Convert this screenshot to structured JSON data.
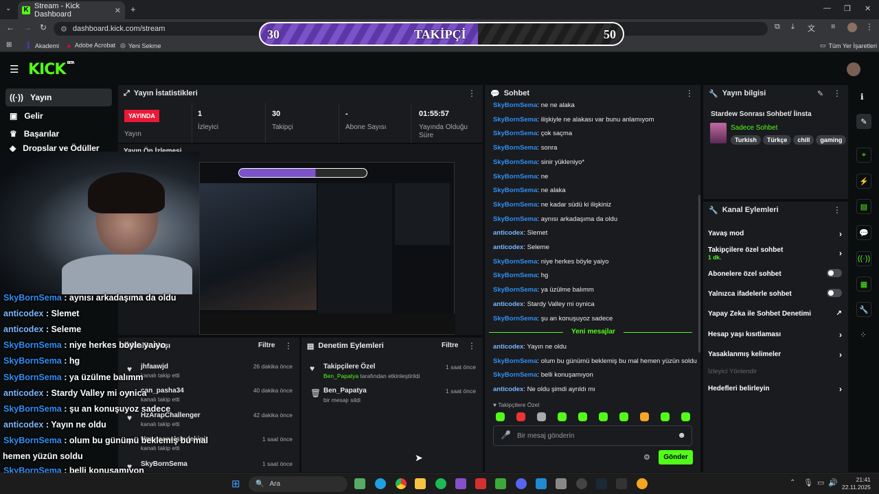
{
  "browser": {
    "tab_title": "Stream - Kick Dashboard",
    "url": "dashboard.kick.com/stream",
    "bookmarks": [
      "Akademi",
      "Adobe Acrobat",
      "Yeni Sekme"
    ],
    "all_bookmarks": "Tüm Yer İşaretleri"
  },
  "goal": {
    "start": "30",
    "label": "TAKİPÇİ",
    "end": "50",
    "progress": 0.6
  },
  "kick": {
    "logo": "KICK",
    "beta": "BETA"
  },
  "sidebar": [
    {
      "label": "Yayın",
      "icon": "broadcast-icon"
    },
    {
      "label": "Gelir",
      "icon": "revenue-icon"
    },
    {
      "label": "Başarılar",
      "icon": "achievements-icon"
    },
    {
      "label": "Dropslar ve Ödüller",
      "icon": "drops-icon"
    }
  ],
  "stats_panel": {
    "title": "Yayın İstatistikleri",
    "live_badge": "YAYINDA",
    "items": [
      {
        "value": "",
        "label": "Yayın"
      },
      {
        "value": "1",
        "label": "İzleyici"
      },
      {
        "value": "30",
        "label": "Takipçi"
      },
      {
        "value": "-",
        "label": "Abone Sayısı"
      },
      {
        "value": "01:55:57",
        "label": "Yayında Olduğu Süre"
      }
    ]
  },
  "preview_title": "Yayın Ön İzlemesi",
  "activity_panel": {
    "title": "Etkinlik Akışı",
    "filter": "Filtre",
    "items": [
      {
        "name": "jhfaawjd",
        "desc": "kanalı takip etti",
        "time": "26 dakika önce"
      },
      {
        "name": "can_pasha34",
        "desc": "kanalı takip etti",
        "time": "40 dakika önce"
      },
      {
        "name": "HzArapChallenger",
        "desc": "kanalı takip etti",
        "time": "42 dakika önce"
      },
      {
        "name": "Umutcanelsindekini",
        "desc": "kanalı takip etti",
        "time": "1 saat önce"
      },
      {
        "name": "SkyBornSema",
        "desc": "",
        "time": "1 saat önce"
      }
    ]
  },
  "mod_panel": {
    "title": "Denetim Eylemleri",
    "filter": "Filtre",
    "items": [
      {
        "name": "Takipçilere Özel",
        "user": "Ben_Papatya",
        "desc": "tarafından etkinleştirildi",
        "time": "1 saat önce"
      },
      {
        "name": "Ben_Papatya",
        "user": "",
        "desc": "bir mesajı sildi",
        "time": "1 saat önce"
      }
    ]
  },
  "chat": {
    "title": "Sohbet",
    "messages": [
      {
        "user": "SkyBornSema",
        "text": "ne ne alaka"
      },
      {
        "user": "SkyBornSema",
        "text": "ilişkiyle ne alakası var bunu anlamıyom"
      },
      {
        "user": "SkyBornSema",
        "text": "çok saçma"
      },
      {
        "user": "SkyBornSema",
        "text": "sonra"
      },
      {
        "user": "SkyBornSema",
        "text": "sinir yükleniyo*"
      },
      {
        "user": "SkyBornSema",
        "text": "ne"
      },
      {
        "user": "SkyBornSema",
        "text": "ne alaka"
      },
      {
        "user": "SkyBornSema",
        "text": "ne kadar südü ki ilişkiniz"
      },
      {
        "user": "SkyBornSema",
        "text": "aynısı arkadaşıma da oldu"
      },
      {
        "user": "anticodex",
        "text": "Slemet"
      },
      {
        "user": "anticodex",
        "text": "Seleme"
      },
      {
        "user": "SkyBornSema",
        "text": "niye herkes böyle yaiyo"
      },
      {
        "user": "SkyBornSema",
        "text": "hg"
      },
      {
        "user": "SkyBornSema",
        "text": "ya üzülme balımm"
      },
      {
        "user": "anticodex",
        "text": "Stardy Valley mi oynica"
      },
      {
        "user": "SkyBornSema",
        "text": "şu an konuşuyoz sadece"
      }
    ],
    "new_messages": "Yeni mesajlar",
    "new": [
      {
        "user": "anticodex",
        "text": "Yayın ne oldu"
      },
      {
        "user": "SkyBornSema",
        "text": "olum bu günümü beklemiş bu mal hemen yüzün soldu"
      },
      {
        "user": "SkyBornSema",
        "text": "belli konuşamıyon"
      },
      {
        "user": "anticodex",
        "text": "Ne oldu şimdi ayrıldı mı"
      }
    ],
    "followers_only": "Takipçilere Özel",
    "placeholder": "Bir mesaj gönderin",
    "send": "Gönder"
  },
  "stream_info": {
    "title": "Yayın bilgisi",
    "stream_title": "Stardew Sonrası Sohbet/ İinsta",
    "category": "Sadece Sohbet",
    "tags": [
      "Turkish",
      "Türkçe",
      "chill",
      "gaming"
    ]
  },
  "channel_actions": {
    "title": "Kanal Eylemleri",
    "items": [
      {
        "label": "Yavaş mod",
        "sub": "",
        "control": "chevron"
      },
      {
        "label": "Takipçilere özel sohbet",
        "sub": "1 dk.",
        "control": "chevron"
      },
      {
        "label": "Abonelere özel sohbet",
        "sub": "",
        "control": "toggle"
      },
      {
        "label": "Yalnızca ifadelerle sohbet",
        "sub": "",
        "control": "toggle"
      },
      {
        "label": "Yapay Zeka ile Sohbet Denetimi",
        "sub": "",
        "control": "external"
      },
      {
        "label": "Hesap yaşı kısıtlaması",
        "sub": "",
        "control": "chevron"
      },
      {
        "label": "Yasaklanmış kelimeler",
        "sub": "",
        "control": "chevron"
      },
      {
        "label": "İzleyici Yönlendir",
        "sub": "",
        "control": "none"
      },
      {
        "label": "Hedefleri belirleyin",
        "sub": "",
        "control": "chevron"
      }
    ]
  },
  "overlay_chat": [
    {
      "user": "SkyBornSema",
      "text": "aynısı arkadaşıma da oldu"
    },
    {
      "user": "anticodex",
      "text": "Slemet"
    },
    {
      "user": "anticodex",
      "text": "Seleme"
    },
    {
      "user": "SkyBornSema",
      "text": "niye herkes böyle yaiyo"
    },
    {
      "user": "SkyBornSema",
      "text": "hg"
    },
    {
      "user": "SkyBornSema",
      "text": "ya üzülme balımm"
    },
    {
      "user": "anticodex",
      "text": "Stardy Valley mi oynica"
    },
    {
      "user": "SkyBornSema",
      "text": "şu an konuşuyoz sadece"
    },
    {
      "user": "anticodex",
      "text": "Yayın ne oldu"
    },
    {
      "user": "SkyBornSema",
      "text": "olum bu günümü beklemiş bu mal"
    },
    {
      "user": "",
      "text": "hemen yüzün soldu"
    },
    {
      "user": "SkyBornSema",
      "text": "belli konuşamıyon"
    },
    {
      "user": "anticodex",
      "text": "Ne oldu şimdi ayrıldı mı"
    }
  ],
  "taskbar": {
    "search": "Ara",
    "time": "21:41",
    "date": "22.11.2025"
  },
  "colors": {
    "kick_green": "#53fc18",
    "user_blue": "#2f8ff5",
    "user_light": "#7eb7ff",
    "live_red": "#e91937",
    "goal_purple": "#7c52c8"
  }
}
